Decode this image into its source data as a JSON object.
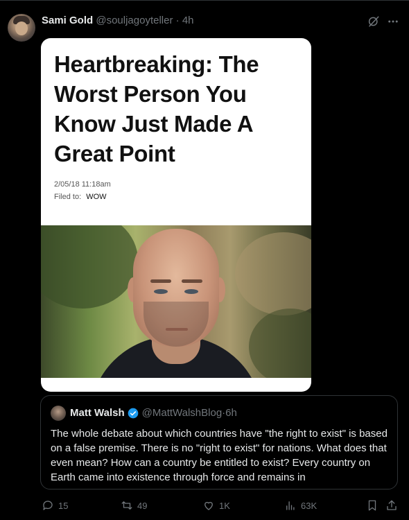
{
  "post": {
    "author_name": "Sami Gold",
    "author_handle": "@souljagoyteller",
    "separator": "·",
    "time": "4h"
  },
  "article": {
    "headline": "Heartbreaking: The Worst Person You Know Just Made A Great Point",
    "date": "2/05/18 11:18am",
    "filed_label": "Filed to:",
    "filed_tag": "WOW"
  },
  "quoted": {
    "author_name": "Matt Walsh",
    "verified": true,
    "author_handle": "@MattWalshBlog",
    "separator": "·",
    "time": "6h",
    "text": "The whole debate about which countries have \"the right to exist\" is based on a false premise. There is no \"right to exist\" for nations. What does that even mean? How can a country be entitled to exist? Every country on Earth came into existence through force and remains in"
  },
  "actions": {
    "replies": "15",
    "reposts": "49",
    "likes": "1K",
    "views": "63K"
  },
  "icons": [
    "grok-icon",
    "more-icon",
    "verified-icon",
    "reply-icon",
    "repost-icon",
    "like-icon",
    "views-icon",
    "bookmark-icon",
    "share-icon"
  ],
  "colors": {
    "background": "#000000",
    "text": "#e7e9ea",
    "muted": "#71767b",
    "border": "#2f3336",
    "verified": "#1d9bf0"
  }
}
